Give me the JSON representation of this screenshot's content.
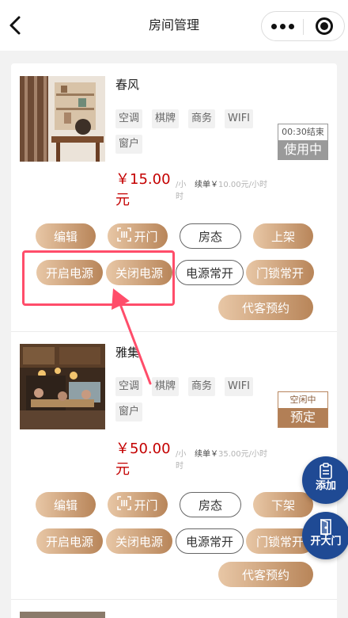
{
  "nav": {
    "title": "房间管理"
  },
  "rooms": [
    {
      "name": "春风",
      "tags": [
        "空调",
        "棋牌",
        "商务",
        "WIFI",
        "窗户"
      ],
      "status_time": "00:30结束",
      "status_label": "使用中",
      "price": "￥15.00元",
      "unit": "/小时",
      "renew_label": "续单￥",
      "renew_value": "10.00元/小时",
      "buttons": {
        "edit": "编辑",
        "open_door": "开门",
        "room_status": "房态",
        "shelf": "上架",
        "power_on": "开启电源",
        "power_off": "关闭电源",
        "power_always": "电源常开",
        "lock_always": "门锁常开",
        "book_for_guest": "代客预约"
      }
    },
    {
      "name": "雅集",
      "tags": [
        "空调",
        "棋牌",
        "商务",
        "WIFI",
        "窗户"
      ],
      "status_time": "空闲中",
      "status_label": "预定",
      "price": "￥50.00元",
      "unit": "/小时",
      "renew_label": "续单￥",
      "renew_value": "35.00元/小时",
      "buttons": {
        "edit": "编辑",
        "open_door": "开门",
        "room_status": "房态",
        "shelf": "下架",
        "power_on": "开启电源",
        "power_off": "关闭电源",
        "power_always": "电源常开",
        "lock_always": "门锁常开",
        "book_for_guest": "代客预约"
      }
    }
  ],
  "fab": {
    "add": "添加",
    "open_main_door": "开大门"
  },
  "colors": {
    "price": "#c40000",
    "accent_gradient_start": "#e8c7a6",
    "accent_gradient_end": "#b88559",
    "fab": "#1f4a94",
    "highlight": "#ff4d6a"
  }
}
